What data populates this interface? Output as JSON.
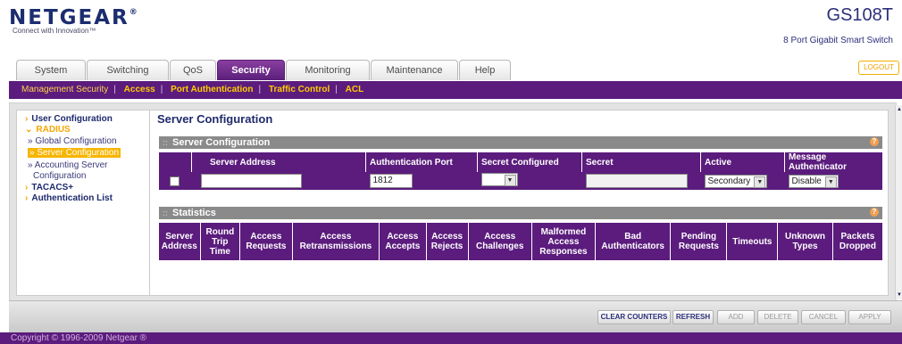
{
  "brand": {
    "logo": "NETGEAR",
    "tagline": "Connect with Innovation™"
  },
  "device": {
    "model": "GS108T",
    "description": "8 Port Gigabit Smart Switch"
  },
  "header": {
    "logout_label": "LOGOUT"
  },
  "tabs": [
    "System",
    "Switching",
    "QoS",
    "Security",
    "Monitoring",
    "Maintenance",
    "Help"
  ],
  "active_tab": "Security",
  "subnav": [
    "Management Security",
    "Access",
    "Port Authentication",
    "Traffic Control",
    "ACL"
  ],
  "sidebar": {
    "user_configuration": "User Configuration",
    "radius": "RADIUS",
    "global_configuration": "» Global Configuration",
    "server_configuration": "» Server Configuration",
    "accounting_1": "» Accounting Server",
    "accounting_2": "Configuration",
    "tacacs": "TACACS+",
    "authentication_list": "Authentication List"
  },
  "page_title": "Server Configuration",
  "server_section": {
    "title": "Server Configuration",
    "columns": [
      "Server Address",
      "Authentication Port",
      "Secret Configured",
      "Secret",
      "Active",
      "Message Authenticator"
    ],
    "row": {
      "server_address": "",
      "auth_port": "1812",
      "secret_configured": "",
      "secret": "",
      "active": "Secondary",
      "message_authenticator": "Disable"
    }
  },
  "stats_section": {
    "title": "Statistics",
    "columns": [
      [
        "Server",
        "Address"
      ],
      [
        "Round",
        "Trip",
        "Time"
      ],
      [
        "Access",
        "Requests"
      ],
      [
        "Access",
        "Retransmissions"
      ],
      [
        "Access",
        "Accepts"
      ],
      [
        "Access",
        "Rejects"
      ],
      [
        "Access",
        "Challenges"
      ],
      [
        "Malformed",
        "Access",
        "Responses"
      ],
      [
        "Bad",
        "Authenticators"
      ],
      [
        "Pending",
        "Requests"
      ],
      [
        "Timeouts"
      ],
      [
        "Unknown",
        "Types"
      ],
      [
        "Packets",
        "Dropped"
      ]
    ]
  },
  "buttons": {
    "clear_counters": "CLEAR COUNTERS",
    "refresh": "REFRESH",
    "add": "ADD",
    "delete": "DELETE",
    "cancel": "CANCEL",
    "apply": "APPLY"
  },
  "copyright": "Copyright © 1996-2009 Netgear ®",
  "colors": {
    "accent": "#5b1c7d",
    "highlight": "#f7b500",
    "header_text": "#2b2f7a"
  }
}
